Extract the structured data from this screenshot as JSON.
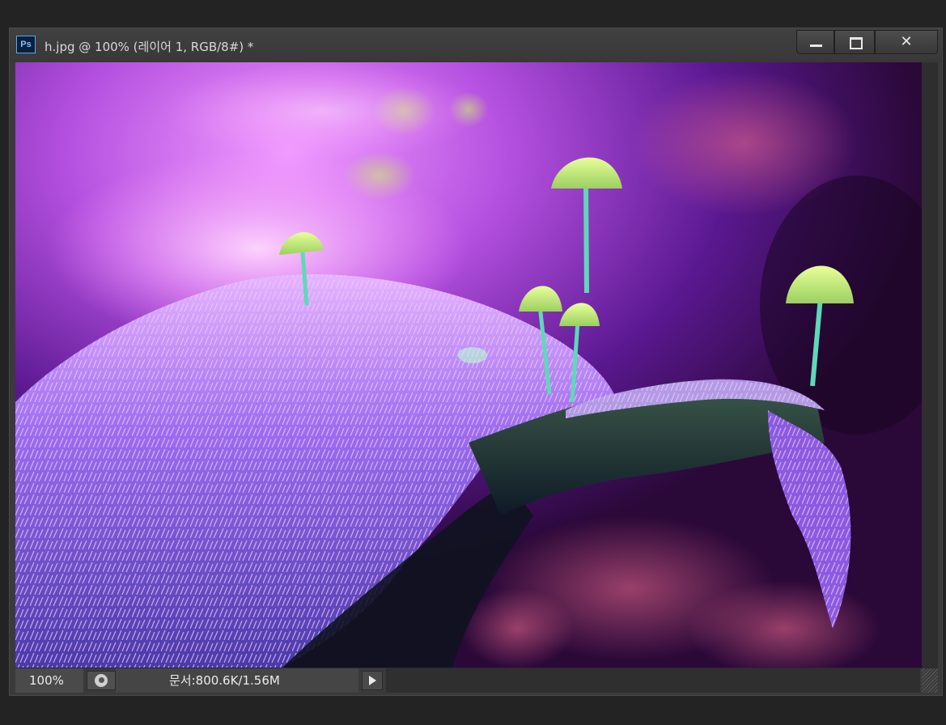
{
  "window": {
    "app_icon": "Ps",
    "title": "h.jpg @ 100% (레이어 1, RGB/8#) *",
    "controls": {
      "minimize_icon": "minimize-icon",
      "maximize_icon": "maximize-icon",
      "close_glyph": "✕"
    }
  },
  "canvas": {
    "image_name": "h.jpg",
    "colors": {
      "background": "#3b0f5a",
      "moss": "#9a6cff",
      "mushroom_cap": "#c9f08a",
      "mushroom_stem": "#4fd0b0"
    }
  },
  "statusbar": {
    "zoom": "100%",
    "doc_info": "문서:800.6K/1.56M"
  }
}
